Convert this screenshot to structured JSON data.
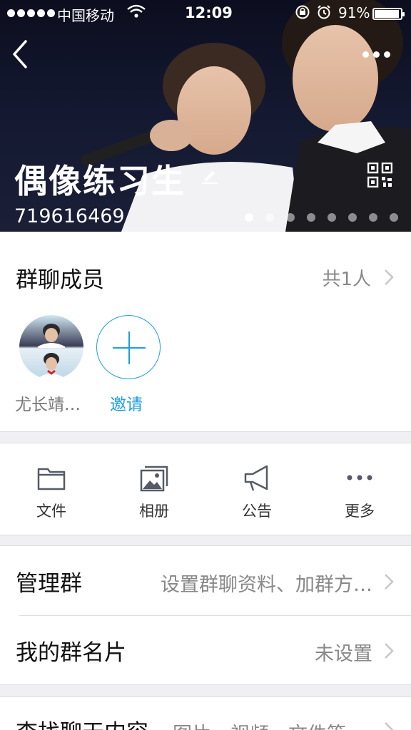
{
  "status_bar": {
    "carrier": "中国移动",
    "time": "12:09",
    "battery": "91%"
  },
  "header": {
    "group_name": "偶像练习生",
    "group_id": "719616469",
    "photo_dots": {
      "count": 8,
      "active_index": 0
    }
  },
  "members": {
    "title": "群聊成员",
    "count": "共1人",
    "list": [
      {
        "name": "尤长靖…"
      }
    ],
    "invite_label": "邀请"
  },
  "actions": [
    {
      "label": "文件",
      "icon": "folder-icon"
    },
    {
      "label": "相册",
      "icon": "album-icon"
    },
    {
      "label": "公告",
      "icon": "megaphone-icon"
    },
    {
      "label": "更多",
      "icon": "more-dots-icon"
    }
  ],
  "settings": {
    "manage": {
      "label": "管理群",
      "value": "设置群聊资料、加群方…"
    },
    "my_card": {
      "label": "我的群名片",
      "value": "未设置"
    },
    "search": {
      "label": "查找聊天内容",
      "value": "图片、视频、文件等"
    }
  },
  "colors": {
    "accent": "#1ea0df",
    "background": "#efeff4"
  }
}
